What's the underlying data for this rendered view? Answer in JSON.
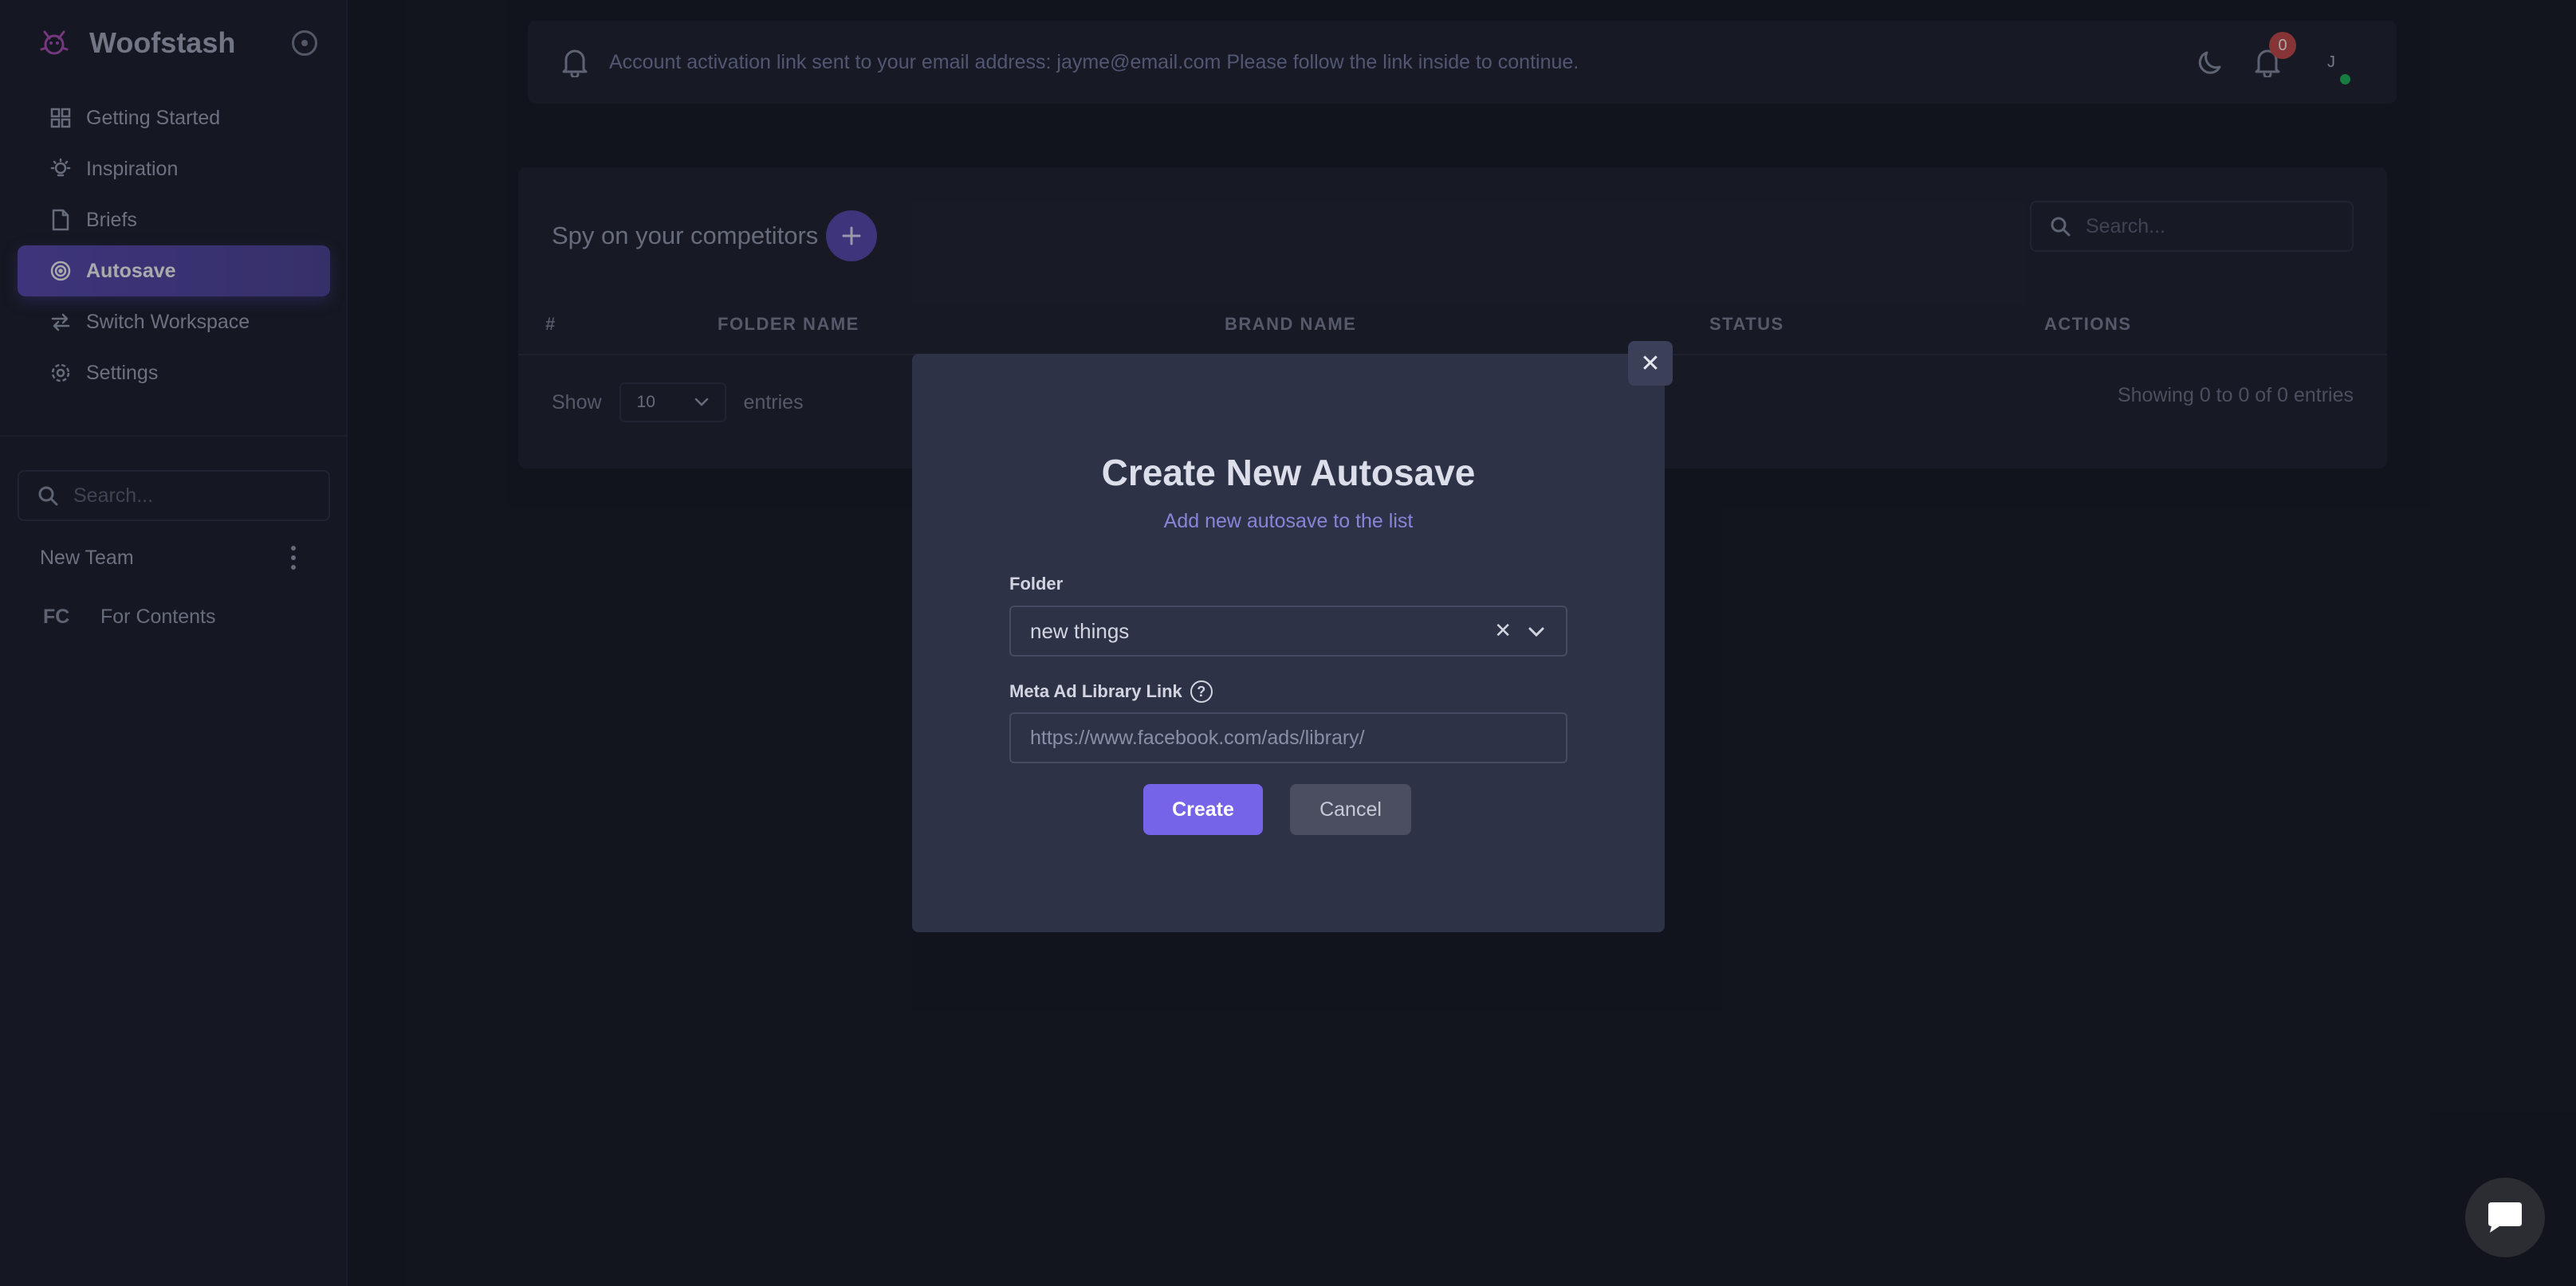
{
  "app": {
    "brand_name": "Woofstash"
  },
  "sidebar": {
    "items": [
      {
        "label": "Getting Started",
        "icon": "grid-icon"
      },
      {
        "label": "Inspiration",
        "icon": "lightbulb-icon"
      },
      {
        "label": "Briefs",
        "icon": "document-icon"
      },
      {
        "label": "Autosave",
        "icon": "target-icon",
        "active": true
      },
      {
        "label": "Switch Workspace",
        "icon": "switch-arrows-icon"
      },
      {
        "label": "Settings",
        "icon": "gear-icon"
      }
    ],
    "search_placeholder": "Search...",
    "team_name": "New Team",
    "workspace": {
      "abbr": "FC",
      "name": "For Contents"
    }
  },
  "notice": {
    "text": "Account activation link sent to your email address: jayme@email.com Please follow the link inside to continue.",
    "notification_count": "0",
    "avatar_initial": "J"
  },
  "table_card": {
    "title": "Spy on your competitors",
    "search_placeholder": "Search...",
    "columns": [
      "#",
      "FOLDER NAME",
      "BRAND NAME",
      "STATUS",
      "ACTIONS"
    ],
    "show_label": "Show",
    "page_size": "10",
    "entries_label": "entries",
    "showing_text": "Showing 0 to 0 of 0 entries"
  },
  "modal": {
    "title": "Create New Autosave",
    "subtitle": "Add new autosave to the list",
    "folder_label": "Folder",
    "folder_value": "new things",
    "link_label": "Meta Ad Library Link",
    "link_placeholder": "https://www.facebook.com/ads/library/",
    "create_label": "Create",
    "cancel_label": "Cancel",
    "close_glyph": "✕"
  },
  "colors": {
    "accent": "#7563e8",
    "active_nav": "#5a4bb5",
    "background": "#171a24",
    "modal_bg": "#2e3247",
    "badge": "#c94a4a",
    "online": "#1fb85a"
  }
}
